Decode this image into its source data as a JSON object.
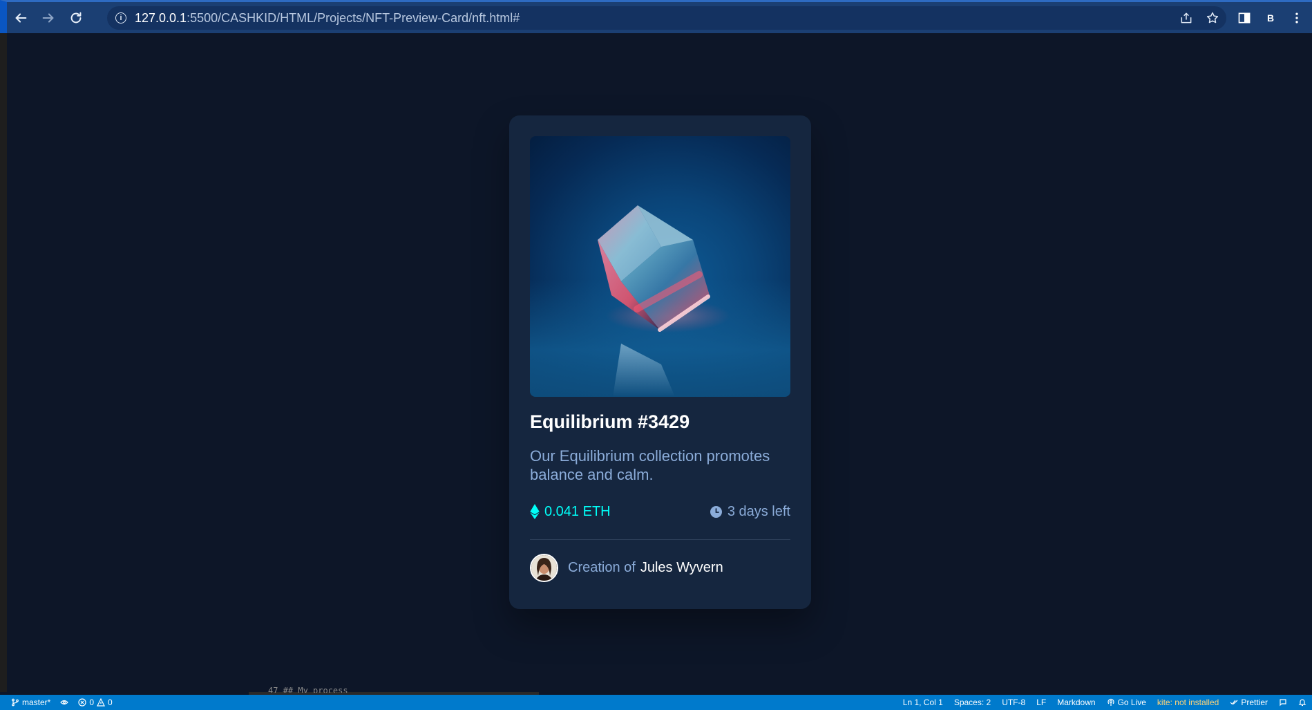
{
  "browser": {
    "url_host": "127.0.0.1",
    "url_path": ":5500/CASHKID/HTML/Projects/NFT-Preview-Card/nft.html#",
    "profile_initial": "B",
    "icons": [
      "back-arrow-icon",
      "forward-arrow-icon",
      "reload-icon",
      "info-icon",
      "share-icon",
      "star-icon",
      "side-panel-icon",
      "more-vert-icon"
    ]
  },
  "card": {
    "title": "Equilibrium #3429",
    "description": "Our Equilibrium collection promotes balance and calm.",
    "price": "0.041 ETH",
    "time_left": "3 days left",
    "creator_label": "Creation of",
    "creator_name": "Jules Wyvern",
    "image_subject": "glass cube on blue background"
  },
  "editor": {
    "remnant_text": "47    ## My process"
  },
  "status_bar": {
    "branch": "master*",
    "errors": "0",
    "warnings": "0",
    "cursor": "Ln 1, Col 1",
    "spaces": "Spaces: 2",
    "encoding": "UTF-8",
    "eol": "LF",
    "language": "Markdown",
    "go_live": "Go Live",
    "kite": "kite: not installed",
    "prettier": "Prettier"
  },
  "colors": {
    "page_bg": "#0d1628",
    "card_bg": "#15263f",
    "accent_cyan": "#00fff8",
    "soft_blue": "#8bacd9",
    "status_bar": "#007acc",
    "browser_bar": "#1b3f73"
  }
}
